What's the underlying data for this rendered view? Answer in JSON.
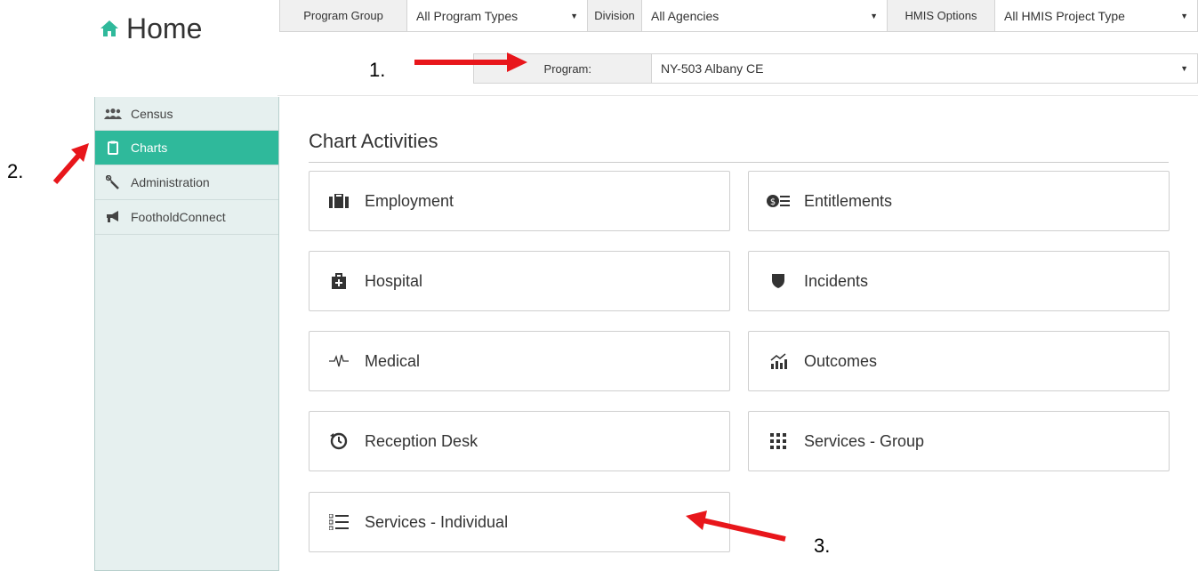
{
  "header": {
    "title": "Home",
    "home_icon": "home-icon"
  },
  "filters": {
    "program_group_label": "Program Group",
    "program_group_value": "All Program Types",
    "division_label": "Division",
    "division_value": "All Agencies",
    "hmis_label": "HMIS Options",
    "hmis_value": "All HMIS Project Type",
    "program_label": "Program:",
    "program_value": "NY-503 Albany CE"
  },
  "sidebar": {
    "items": [
      {
        "label": "Census",
        "icon": "users-icon"
      },
      {
        "label": "Charts",
        "icon": "clipboard-icon",
        "active": true
      },
      {
        "label": "Administration",
        "icon": "wrench-icon"
      },
      {
        "label": "FootholdConnect",
        "icon": "megaphone-icon"
      }
    ]
  },
  "main": {
    "section_title": "Chart Activities",
    "cards": [
      {
        "label": "Employment",
        "icon": "briefcase-icon"
      },
      {
        "label": "Entitlements",
        "icon": "entitlements-icon"
      },
      {
        "label": "Hospital",
        "icon": "medkit-icon"
      },
      {
        "label": "Incidents",
        "icon": "shield-icon"
      },
      {
        "label": "Medical",
        "icon": "heartbeat-icon"
      },
      {
        "label": "Outcomes",
        "icon": "chart-growth-icon"
      },
      {
        "label": "Reception Desk",
        "icon": "history-icon"
      },
      {
        "label": "Services - Group",
        "icon": "grid-dots-icon"
      },
      {
        "label": "Services - Individual",
        "icon": "list-icon"
      }
    ]
  },
  "annotations": {
    "one": "1.",
    "two": "2.",
    "three": "3.",
    "arrow_color": "#e8161b"
  },
  "colors": {
    "accent": "#2fb99b",
    "sidebar_bg": "#e6f0ef"
  }
}
